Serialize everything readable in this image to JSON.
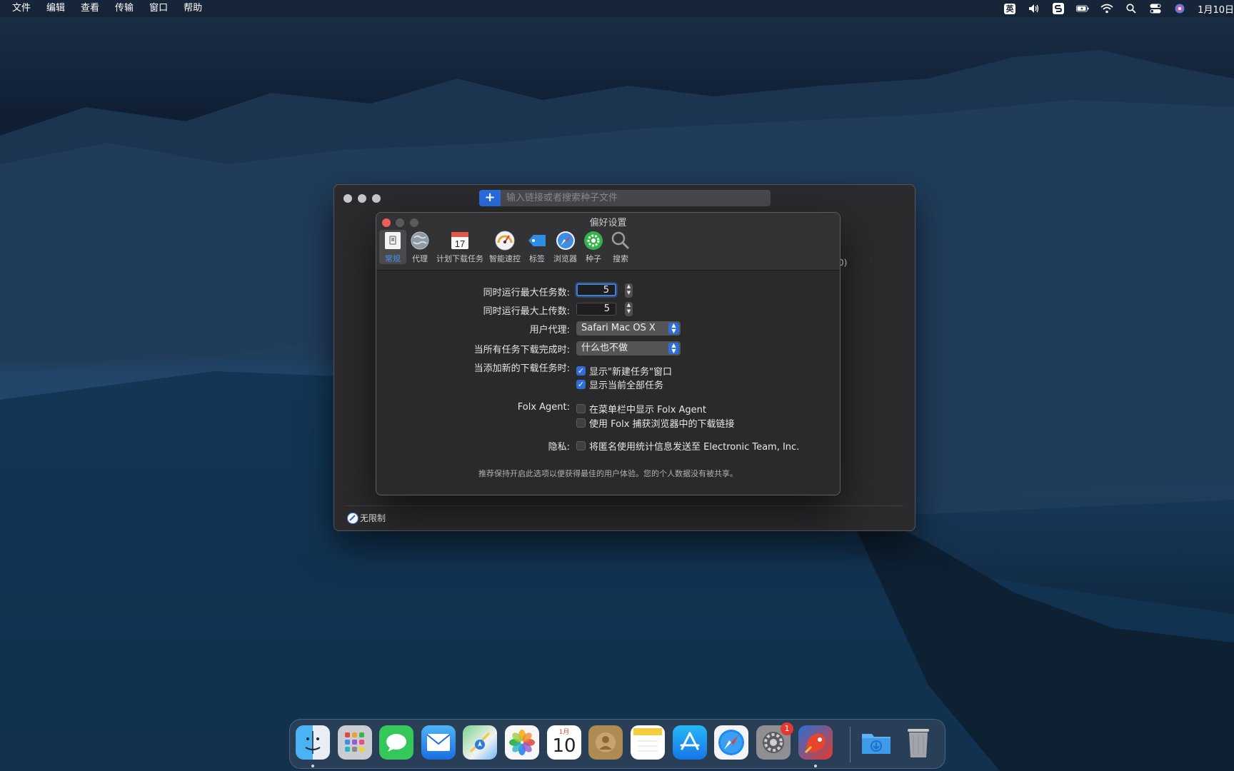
{
  "menubar": {
    "items": [
      "文件",
      "编辑",
      "查看",
      "传输",
      "窗口",
      "帮助"
    ],
    "input_method": "英",
    "clock": "1月10日"
  },
  "main_window": {
    "search_placeholder": "输入链接或者搜索种子文件",
    "add_button": "+",
    "speed_mode": "无限制",
    "side_fragment": "0)"
  },
  "preferences": {
    "title": "偏好设置",
    "toolbar": [
      {
        "label": "常规",
        "icon": "general-icon",
        "active": true
      },
      {
        "label": "代理",
        "icon": "proxy-globe-icon"
      },
      {
        "label": "计划下载任务",
        "icon": "calendar-icon"
      },
      {
        "label": "智能速控",
        "icon": "speedometer-icon"
      },
      {
        "label": "标签",
        "icon": "tag-icon"
      },
      {
        "label": "浏览器",
        "icon": "compass-icon"
      },
      {
        "label": "种子",
        "icon": "gear-seed-icon"
      },
      {
        "label": "搜索",
        "icon": "magnifier-icon"
      }
    ],
    "calendar_day": "17",
    "max_tasks_label": "同时运行最大任务数:",
    "max_tasks_value": "5",
    "max_uploads_label": "同时运行最大上传数:",
    "max_uploads_value": "5",
    "user_agent_label": "用户代理:",
    "user_agent_value": "Safari Mac OS X",
    "on_complete_label": "当所有任务下载完成时:",
    "on_complete_value": "什么也不做",
    "on_add_label": "当添加新的下载任务时:",
    "show_new_task_window": {
      "label": "显示\"新建任务\"窗口",
      "checked": true
    },
    "show_all_tasks": {
      "label": "显示当前全部任务",
      "checked": true
    },
    "folx_agent_label": "Folx Agent:",
    "show_in_menubar": {
      "label": "在菜单栏中显示 Folx Agent",
      "checked": false
    },
    "capture_browser": {
      "label": "使用 Folx 捕获浏览器中的下载链接",
      "checked": false
    },
    "privacy_label": "隐私:",
    "send_stats": {
      "label": "将匿名使用统计信息发送至 Electronic Team, Inc.",
      "checked": false
    },
    "note": "推荐保持开启此选项以便获得最佳的用户体验。您的个人数据没有被共享。"
  },
  "dock": {
    "apps": [
      "finder-icon",
      "launchpad-icon",
      "messages-icon",
      "mail-icon",
      "maps-icon",
      "photos-icon",
      "calendar-icon",
      "contacts-icon",
      "notes-icon",
      "app-store-icon",
      "safari-icon",
      "system-preferences-icon",
      "folx-icon"
    ],
    "calendar_month": "1月",
    "calendar_day": "10",
    "sys_pref_badge": "1"
  },
  "colors": {
    "accent": "#2f6ed8",
    "close": "#ec5f57"
  }
}
